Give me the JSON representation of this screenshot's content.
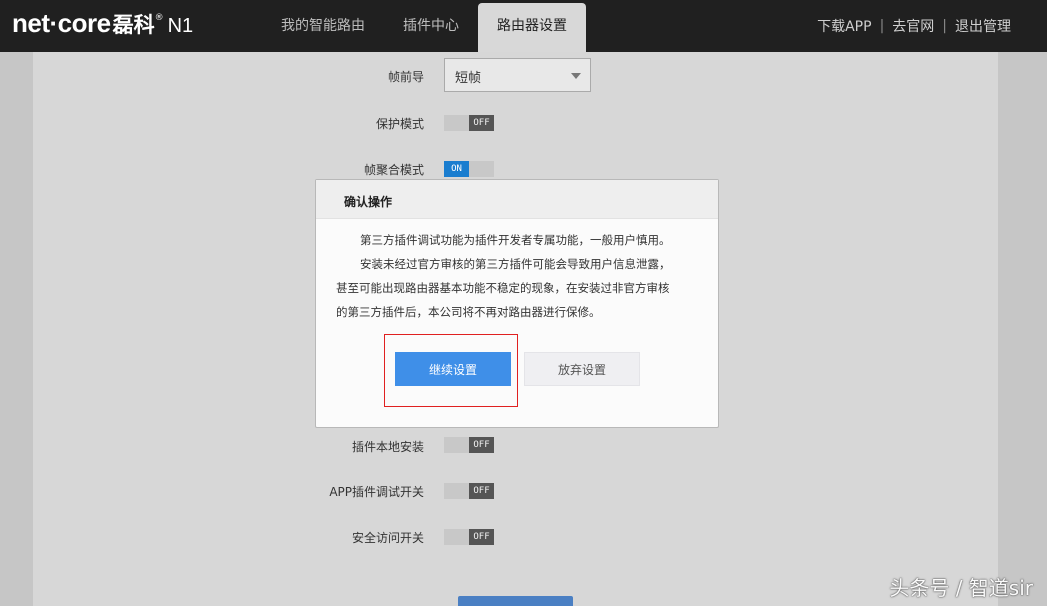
{
  "brand": {
    "name": "net·core",
    "cn_name": "磊科",
    "model": "N1"
  },
  "nav": {
    "tabs": [
      {
        "label": "我的智能路由",
        "active": false
      },
      {
        "label": "插件中心",
        "active": false
      },
      {
        "label": "路由器设置",
        "active": true
      }
    ]
  },
  "topright": {
    "download": "下载APP",
    "site": "去官网",
    "logout": "退出管理"
  },
  "settings": {
    "preamble": {
      "label": "帧前导",
      "value": "短帧"
    },
    "protect": {
      "label": "保护模式",
      "state": "OFF"
    },
    "aggregation": {
      "label": "帧聚合模式",
      "state": "ON"
    },
    "local_install": {
      "label": "插件本地安装",
      "state": "OFF"
    },
    "app_debug": {
      "label": "APP插件调试开关",
      "state": "OFF"
    },
    "secure_access": {
      "label": "安全访问开关",
      "state": "OFF"
    }
  },
  "modal": {
    "title": "确认操作",
    "line1": "第三方插件调试功能为插件开发者专属功能，一般用户慎用。",
    "line2": "安装未经过官方审核的第三方插件可能会导致用户信息泄露，",
    "line3": "甚至可能出现路由器基本功能不稳定的现象，在安装过非官方审核",
    "line4": "的第三方插件后，本公司将不再对路由器进行保修。",
    "continue_label": "继续设置",
    "abandon_label": "放弃设置"
  },
  "watermark": "头条号 / 智道sir",
  "colors": {
    "header": "#202020",
    "primary": "#3f8fe8",
    "toggle_on": "#1a7dcf",
    "highlight": "#e02020"
  }
}
